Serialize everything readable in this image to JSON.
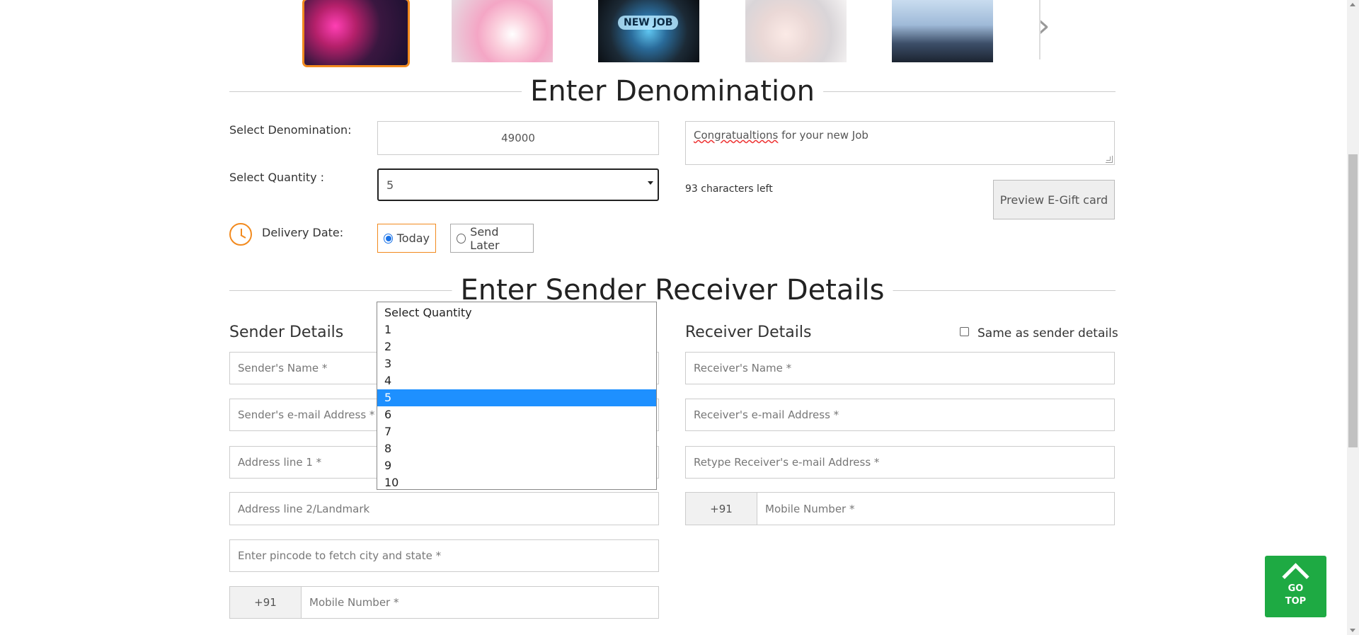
{
  "carousel": {
    "items": [
      {
        "name": "party"
      },
      {
        "name": "baby-shower"
      },
      {
        "name": "new-job",
        "label": "NEW JOB"
      },
      {
        "name": "newborn"
      },
      {
        "name": "graduation"
      }
    ],
    "next_icon": "chevron-right-icon"
  },
  "denomination": {
    "title": "Enter Denomination",
    "denomination_label": "Select Denomination:",
    "denomination_value": "49000",
    "quantity_label": "Select Quantity :",
    "quantity_value": "5",
    "delivery_label": "Delivery Date:",
    "delivery_today": "Today",
    "delivery_later": "Send Later",
    "message_word1": "Congratualtions",
    "message_rest": " for your new Job",
    "chars_left": "93 characters left",
    "preview_button": "Preview E-Gift card"
  },
  "quantity_dropdown": {
    "options": [
      "Select Quantity",
      "1",
      "2",
      "3",
      "4",
      "5",
      "6",
      "7",
      "8",
      "9",
      "10"
    ],
    "selected": "5"
  },
  "details": {
    "title": "Enter Sender Receiver Details",
    "sender": {
      "heading": "Sender Details",
      "name_ph": "Sender's Name *",
      "email_ph": "Sender's e-mail Address *",
      "addr1_ph": "Address line 1 *",
      "addr2_ph": "Address line 2/Landmark",
      "pincode_ph": "Enter pincode to fetch city and state *",
      "country_code": "+91",
      "mobile_ph": "Mobile Number *"
    },
    "receiver": {
      "heading": "Receiver Details",
      "same_as_sender": "Same as sender details",
      "name_ph": "Receiver's Name *",
      "email_ph": "Receiver's e-mail Address *",
      "retype_email_ph": "Retype Receiver's e-mail Address *",
      "country_code": "+91",
      "mobile_ph": "Mobile Number *"
    }
  },
  "go_top": {
    "line1": "GO",
    "line2": "TOP"
  }
}
